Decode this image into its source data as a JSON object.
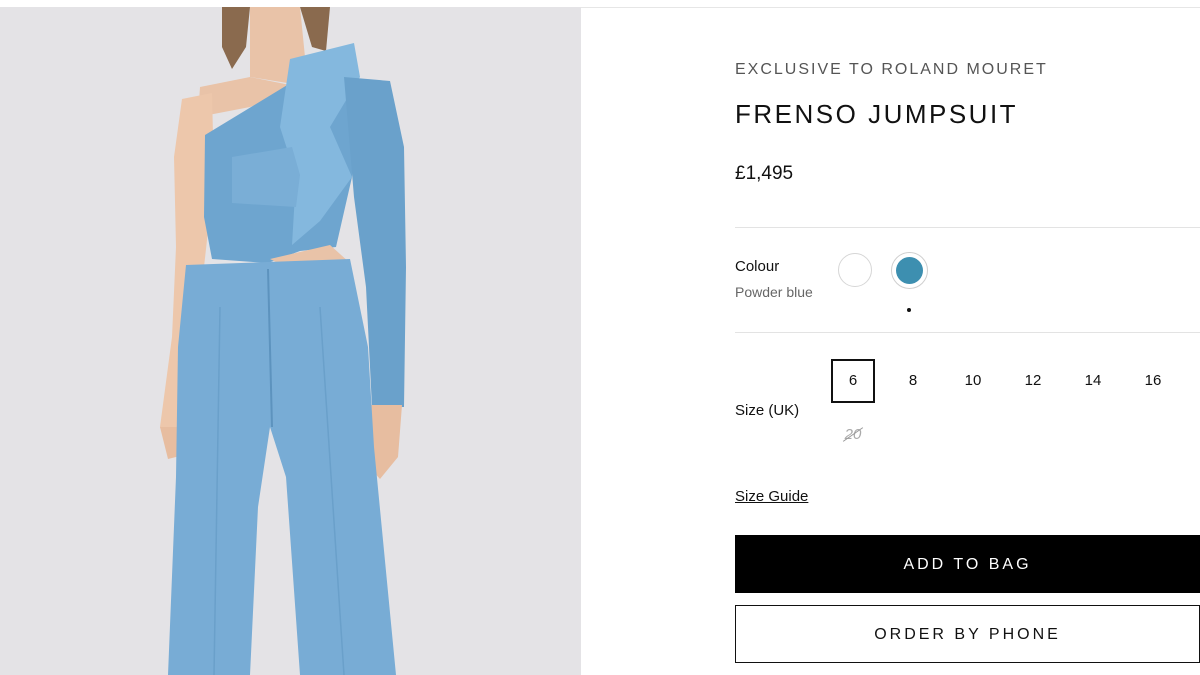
{
  "product": {
    "brand": "EXCLUSIVE TO ROLAND MOURET",
    "title": "FRENSO JUMPSUIT",
    "price": "£1,495",
    "image_alt": "model-wearing-powder-blue-jumpsuit"
  },
  "colour": {
    "label": "Colour",
    "selected_name": "Powder blue",
    "swatches": [
      {
        "name": "white",
        "hex": "#ffffff"
      },
      {
        "name": "powder-blue",
        "hex": "#3d8fb0"
      }
    ]
  },
  "size": {
    "label": "Size (UK)",
    "options": [
      {
        "value": "6",
        "state": "selected"
      },
      {
        "value": "8",
        "state": "available"
      },
      {
        "value": "10",
        "state": "available"
      },
      {
        "value": "12",
        "state": "available"
      },
      {
        "value": "14",
        "state": "available"
      },
      {
        "value": "16",
        "state": "available"
      },
      {
        "value": "20",
        "state": "unavailable"
      }
    ]
  },
  "links": {
    "size_guide": "Size Guide"
  },
  "actions": {
    "add_to_bag": "ADD TO BAG",
    "order_by_phone": "ORDER BY PHONE"
  },
  "colors": {
    "garment": "#7aaed6",
    "background": "#e4e3e6",
    "button": "#000000"
  }
}
